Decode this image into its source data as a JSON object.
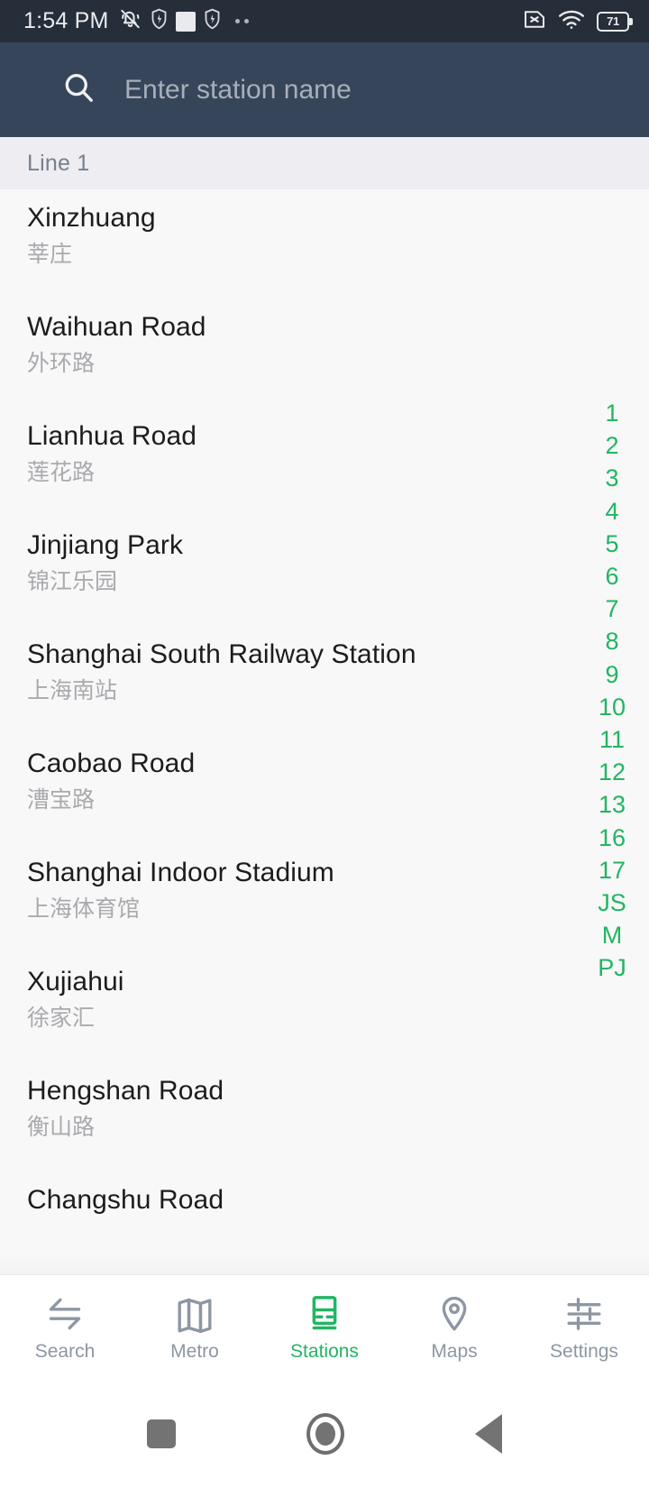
{
  "status_bar": {
    "time": "1:54 PM",
    "battery_level": "71",
    "left_icons": [
      "vibrate-off-icon",
      "shield-icon",
      "square-icon",
      "shield-icon",
      "more-dots-icon"
    ],
    "right_icons": [
      "sim-card-missing-icon",
      "wifi-icon",
      "battery-icon"
    ],
    "background_color": "#262E3A"
  },
  "search": {
    "placeholder": "Enter station name",
    "value": "",
    "icon": "search-icon",
    "background_color": "#37455A"
  },
  "section": {
    "line_label": "Line 1",
    "background_color": "#EDEDF2"
  },
  "stations": [
    {
      "en": "Xinzhuang",
      "cn": "莘庄"
    },
    {
      "en": "Waihuan Road",
      "cn": "外环路"
    },
    {
      "en": "Lianhua Road",
      "cn": "莲花路"
    },
    {
      "en": "Jinjiang Park",
      "cn": "锦江乐园"
    },
    {
      "en": "Shanghai South Railway Station",
      "cn": "上海南站"
    },
    {
      "en": "Caobao Road",
      "cn": "漕宝路"
    },
    {
      "en": "Shanghai Indoor Stadium",
      "cn": "上海体育馆"
    },
    {
      "en": "Xujiahui",
      "cn": "徐家汇"
    },
    {
      "en": "Hengshan Road",
      "cn": "衡山路"
    },
    {
      "en": "Changshu Road",
      "cn": ""
    }
  ],
  "index_rail": {
    "accent_color": "#22B563",
    "entries": [
      "1",
      "2",
      "3",
      "4",
      "5",
      "6",
      "7",
      "8",
      "9",
      "10",
      "11",
      "12",
      "13",
      "16",
      "17",
      "JS",
      "M",
      "PJ"
    ]
  },
  "bottom_nav": {
    "active_color": "#22B563",
    "inactive_color": "#8D97A3",
    "items": [
      {
        "label": "Search",
        "icon": "transfer-arrows-icon",
        "active": false
      },
      {
        "label": "Metro",
        "icon": "folded-map-icon",
        "active": false
      },
      {
        "label": "Stations",
        "icon": "train-icon",
        "active": true
      },
      {
        "label": "Maps",
        "icon": "map-pin-icon",
        "active": false
      },
      {
        "label": "Settings",
        "icon": "sliders-icon",
        "active": false
      }
    ]
  },
  "system_nav": {
    "buttons": [
      "recents-square-icon",
      "home-circle-icon",
      "back-triangle-icon"
    ]
  }
}
